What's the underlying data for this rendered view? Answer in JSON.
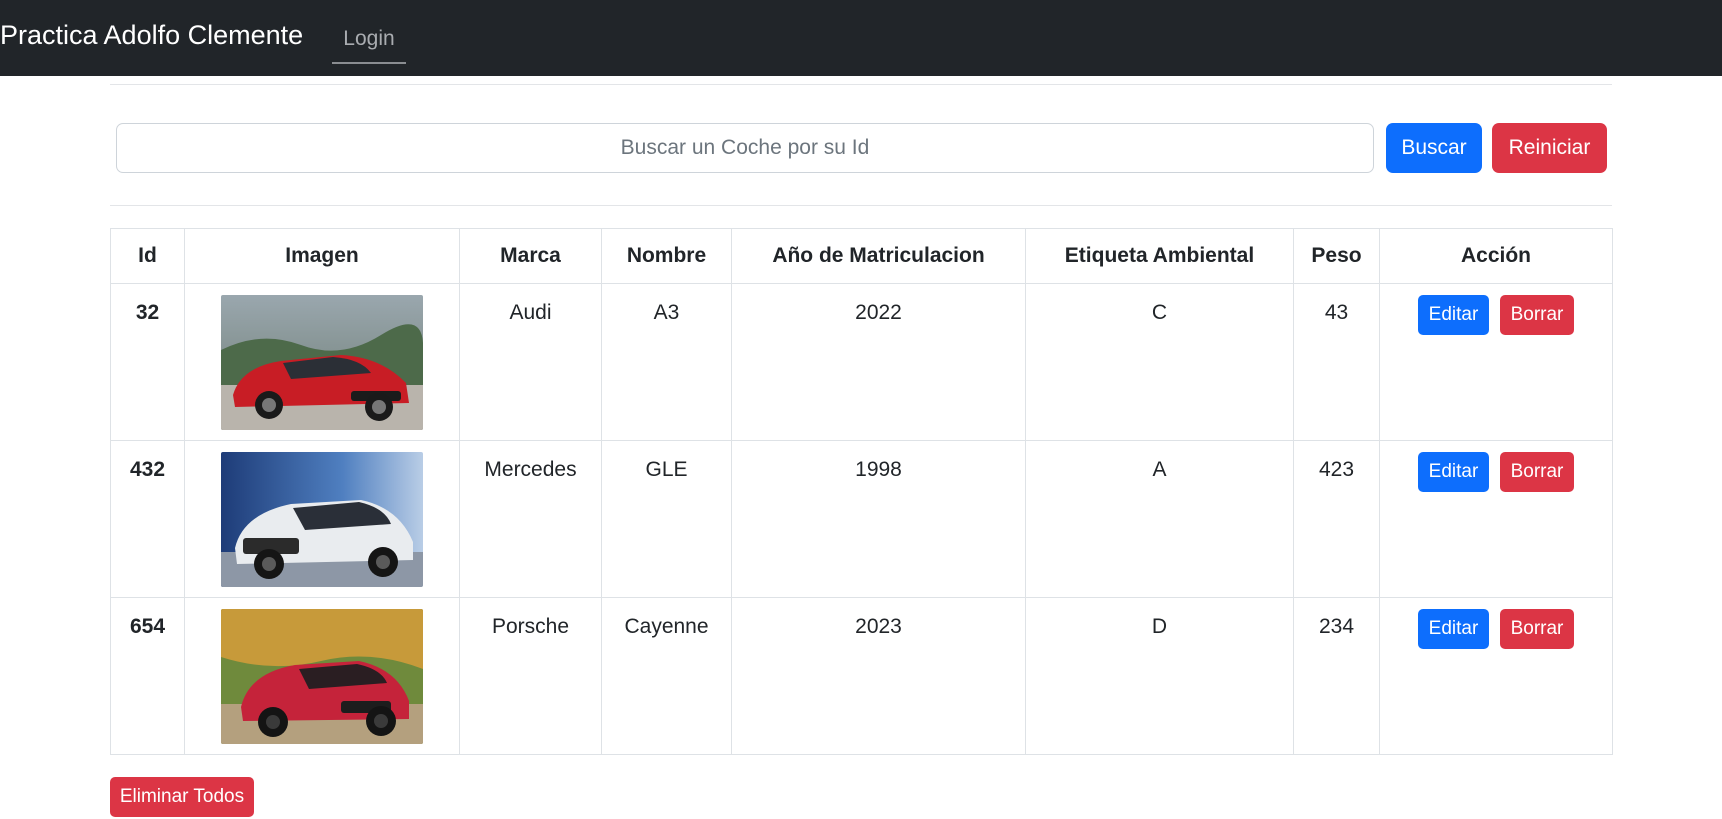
{
  "navbar": {
    "brand": "Practica Adolfo Clemente",
    "login_label": "Login"
  },
  "search": {
    "placeholder": "Buscar un Coche por su Id",
    "value": "",
    "search_button": "Buscar",
    "reset_button": "Reiniciar"
  },
  "table": {
    "headers": [
      "Id",
      "Imagen",
      "Marca",
      "Nombre",
      "Año de Matriculacion",
      "Etiqueta Ambiental",
      "Peso",
      "Acción"
    ],
    "rows": [
      {
        "id": "32",
        "image": "red-audi-a3-photo",
        "marca": "Audi",
        "nombre": "A3",
        "anio": "2022",
        "etiqueta": "C",
        "peso": "43",
        "edit_label": "Editar",
        "delete_label": "Borrar"
      },
      {
        "id": "432",
        "image": "white-mercedes-gle-photo",
        "marca": "Mercedes",
        "nombre": "GLE",
        "anio": "1998",
        "etiqueta": "A",
        "peso": "423",
        "edit_label": "Editar",
        "delete_label": "Borrar"
      },
      {
        "id": "654",
        "image": "red-porsche-cayenne-photo",
        "marca": "Porsche",
        "nombre": "Cayenne",
        "anio": "2023",
        "etiqueta": "D",
        "peso": "234",
        "edit_label": "Editar",
        "delete_label": "Borrar"
      }
    ]
  },
  "delete_all_label": "Eliminar Todos",
  "colors": {
    "navbar_bg": "#212529",
    "primary": "#0d6efd",
    "danger": "#dc3545",
    "border": "#dee2e6"
  }
}
